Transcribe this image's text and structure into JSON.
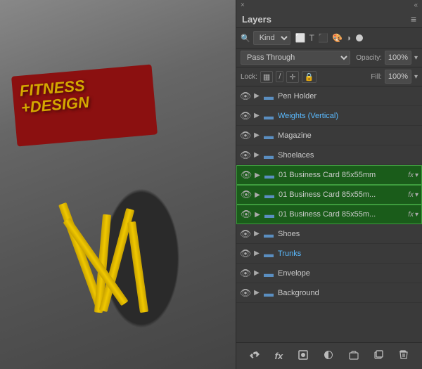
{
  "canvas": {
    "bg_color": "#5a5a5a"
  },
  "panel": {
    "title": "Layers",
    "close_label": "×",
    "collapse_label": "«",
    "menu_label": "≡",
    "filter_row": {
      "search_icon": "🔍",
      "kind_label": "Kind",
      "filter_icons": [
        "img",
        "T",
        "⬜",
        "🎨",
        "⬛"
      ]
    },
    "blend_row": {
      "blend_mode": "Pass Through",
      "opacity_label": "Opacity:",
      "opacity_value": "100%",
      "arrow": "▾"
    },
    "lock_row": {
      "lock_label": "Lock:",
      "lock_icons": [
        "▦",
        "/",
        "✛",
        "🔒"
      ],
      "fill_label": "Fill:",
      "fill_value": "100%",
      "arrow": "▾"
    },
    "layers": [
      {
        "id": 1,
        "name": "Pen Holder",
        "type": "folder",
        "color": "normal",
        "visible": true,
        "expanded": false,
        "fx": false,
        "highlighted": false
      },
      {
        "id": 2,
        "name": "Weights (Vertical)",
        "type": "folder",
        "color": "blue",
        "visible": true,
        "expanded": false,
        "fx": false,
        "highlighted": false
      },
      {
        "id": 3,
        "name": "Magazine",
        "type": "folder",
        "color": "normal",
        "visible": true,
        "expanded": false,
        "fx": false,
        "highlighted": false
      },
      {
        "id": 4,
        "name": "Shoelaces",
        "type": "folder",
        "color": "normal",
        "visible": true,
        "expanded": false,
        "fx": false,
        "highlighted": false
      },
      {
        "id": 5,
        "name": "01 Business Card 85x55mm",
        "type": "folder",
        "color": "normal",
        "visible": true,
        "expanded": false,
        "fx": true,
        "highlighted": true
      },
      {
        "id": 6,
        "name": "01 Business Card 85x55m...",
        "type": "folder",
        "color": "normal",
        "visible": true,
        "expanded": false,
        "fx": true,
        "highlighted": true
      },
      {
        "id": 7,
        "name": "01 Business Card 85x55m...",
        "type": "folder",
        "color": "normal",
        "visible": true,
        "expanded": false,
        "fx": true,
        "highlighted": true
      },
      {
        "id": 8,
        "name": "Shoes",
        "type": "folder",
        "color": "normal",
        "visible": true,
        "expanded": false,
        "fx": false,
        "highlighted": false
      },
      {
        "id": 9,
        "name": "Trunks",
        "type": "folder",
        "color": "blue",
        "visible": true,
        "expanded": false,
        "fx": false,
        "highlighted": false
      },
      {
        "id": 10,
        "name": "Envelope",
        "type": "folder",
        "color": "normal",
        "visible": true,
        "expanded": false,
        "fx": false,
        "highlighted": false
      },
      {
        "id": 11,
        "name": "Background",
        "type": "folder",
        "color": "normal",
        "visible": true,
        "expanded": false,
        "fx": false,
        "highlighted": false
      }
    ],
    "bottom_toolbar": {
      "link_icon": "🔗",
      "fx_icon": "fx",
      "mask_icon": "⬜",
      "adjust_icon": "◑",
      "group_icon": "📁",
      "duplicate_icon": "⬜",
      "delete_icon": "🗑"
    }
  }
}
